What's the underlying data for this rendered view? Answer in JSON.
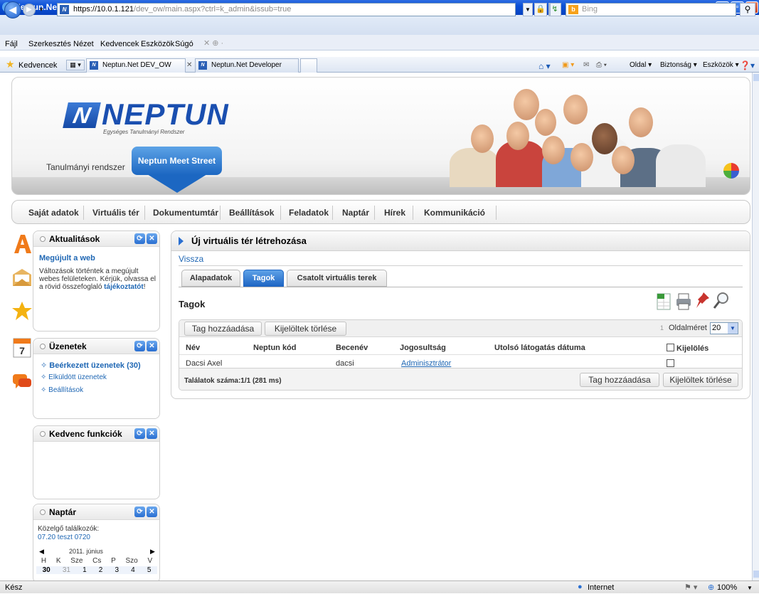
{
  "window": {
    "title": "Neptun.Net DEV_OW - Windows Internet Explorer"
  },
  "address": {
    "url_main": "https://10.0.1.121",
    "url_rest": "/dev_ow/main.aspx?ctrl=k_admin&issub=true",
    "search_placeholder": "Bing"
  },
  "menubar": [
    "Fájl",
    "Szerkesztés",
    "Nézet",
    "Kedvencek",
    "Eszközök",
    "Súgó"
  ],
  "favbar": {
    "favorites_label": "Kedvencek",
    "tabs": [
      "Neptun.Net DEV_OW",
      "Neptun.Net Developer"
    ],
    "commands": [
      "Oldal ▾",
      "Biztonság ▾",
      "Eszközök ▾"
    ]
  },
  "header": {
    "logo_text": "NEPTUN",
    "logo_sub": "Egységes Tanulmányi Rendszer",
    "nav_tanulmanyi": "Tanulmányi rendszer",
    "nav_meet": "Neptun Meet Street"
  },
  "hmenu": [
    "Saját adatok",
    "Virtuális tér",
    "Dokumentumtár",
    "Beállítások",
    "Feladatok",
    "Naptár",
    "Hírek",
    "Kommunikáció"
  ],
  "aktualitasok": {
    "title": "Aktualitások",
    "headline": "Megújult a web",
    "text": "Változások történtek a megújult webes felületeken. Kérjük, olvassa el a rövid összefoglaló",
    "link": "tájékoztatót",
    "tail": "!"
  },
  "uzenetek": {
    "title": "Üzenetek",
    "items": [
      "Beérkezett üzenetek (30)",
      "Elküldött üzenetek",
      "Beállítások"
    ]
  },
  "kedvenc": {
    "title": "Kedvenc funkciók"
  },
  "naptar": {
    "title": "Naptár",
    "upcoming_label": "Közelgő találkozók:",
    "upcoming_item": "07.20 teszt 0720",
    "month": "2011. június",
    "days": [
      "H",
      "K",
      "Sze",
      "Cs",
      "P",
      "Szo",
      "V"
    ],
    "dates": [
      "30",
      "31",
      "1",
      "2",
      "3",
      "4",
      "5"
    ]
  },
  "main": {
    "title": "Új virtuális tér létrehozása",
    "back": "Vissza",
    "tabs": [
      "Alapadatok",
      "Tagok",
      "Csatolt virtuális terek"
    ],
    "section": "Tagok",
    "add_btn": "Tag hozzáadása",
    "delete_btn": "Kijelöltek törlése",
    "page_num": "1",
    "page_size_label": "Oldalméret",
    "page_size": "20",
    "columns": [
      "Név",
      "Neptun kód",
      "Becenév",
      "Jogosultság",
      "Utolsó látogatás dátuma",
      "Kijelölés"
    ],
    "row": {
      "name": "Dacsi Axel",
      "code": "",
      "nick": "dacsi",
      "role": "Adminisztrátor",
      "last": ""
    },
    "count_text": "Találatok száma:1/1 (281 ms)",
    "foot_add": "Tag hozzáadása",
    "foot_delete": "Kijelöltek törlése"
  },
  "status": {
    "left": "Kész",
    "zone": "Internet",
    "zoom": "100%"
  }
}
